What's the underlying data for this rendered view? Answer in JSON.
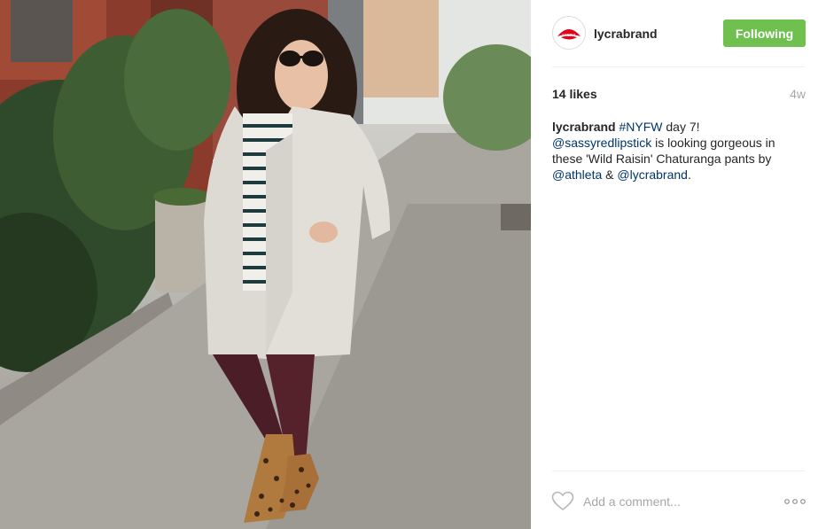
{
  "post": {
    "username": "lycrabrand",
    "follow_button": "Following",
    "likes": "14 likes",
    "time_ago": "4w",
    "caption": {
      "author": "lycrabrand",
      "hashtag": "#NYFW",
      "text1": " day 7!",
      "mention1": "@sassyredlipstick",
      "text2": " is looking gorgeous in these 'Wild Raisin' Chaturanga pants by ",
      "mention2": "@athleta",
      "text3": " & ",
      "mention3": "@lycrabrand",
      "text4": "."
    },
    "comment_placeholder": "Add a comment...",
    "logo_text": "LYCRA"
  },
  "icons": {
    "like": "heart-outline-icon",
    "more": "ellipsis-icon"
  },
  "colors": {
    "follow_green": "#70c050",
    "link_blue": "#003569",
    "meta_gray": "#a5a7aa",
    "logo_red": "#e3001b"
  }
}
